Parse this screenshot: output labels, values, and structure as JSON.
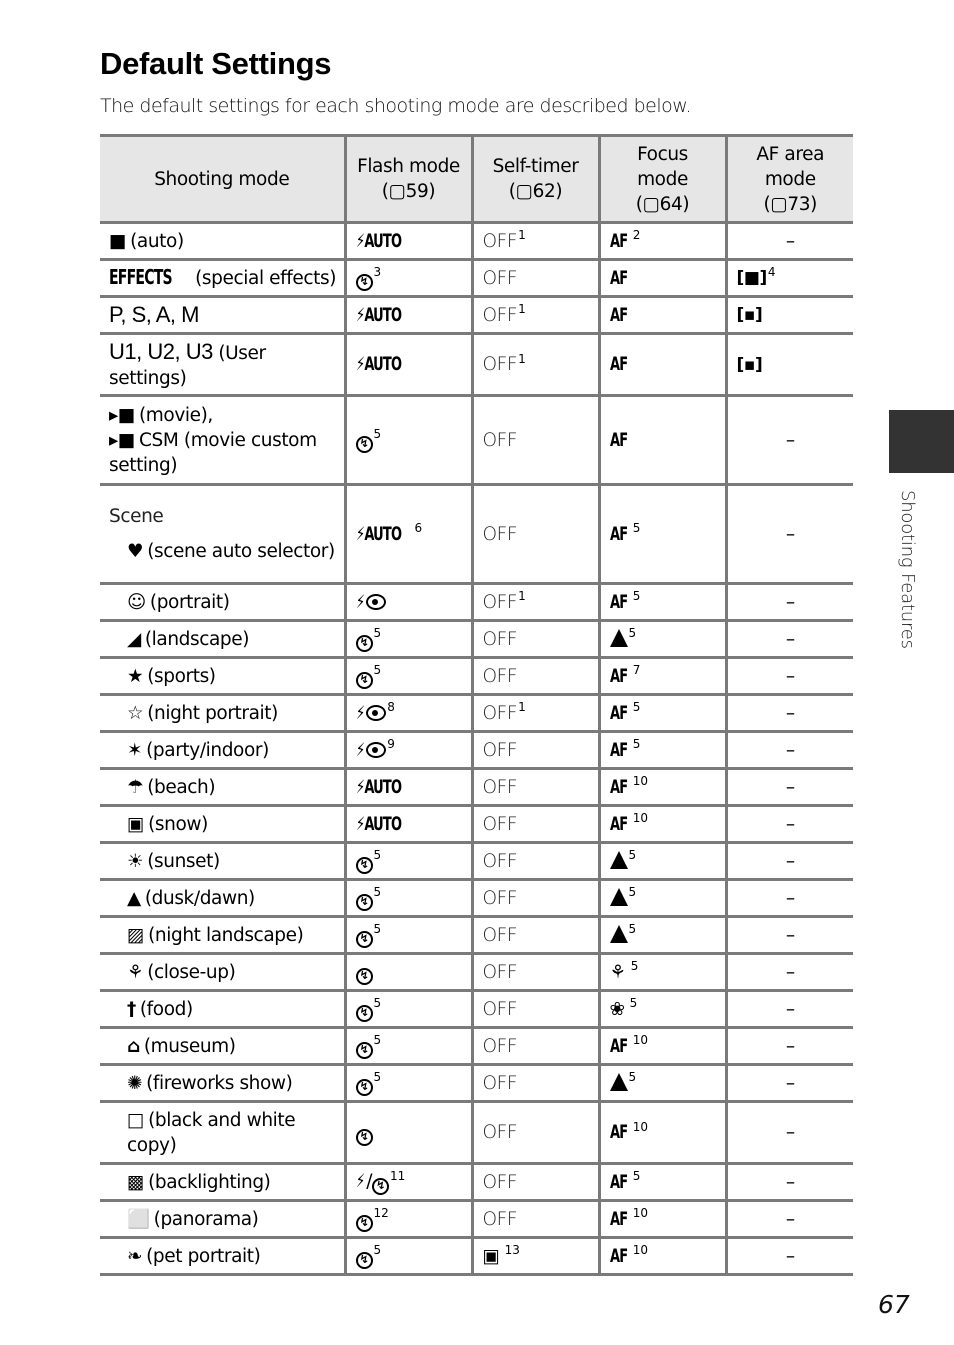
{
  "page": {
    "title": "Default Settings",
    "intro": "The default settings for each shooting mode are described below.",
    "side_tab_label": "Shooting Features",
    "page_number": "67"
  },
  "table": {
    "headers": [
      {
        "line1": "Shooting mode",
        "line2": "",
        "line3": ""
      },
      {
        "line1": "Flash mode",
        "line2": "(▢59)",
        "line3": ""
      },
      {
        "line1": "Self-timer",
        "line2": "(▢62)",
        "line3": ""
      },
      {
        "line1": "Focus",
        "line2": "mode",
        "line3": "(▢64)"
      },
      {
        "line1": "AF area",
        "line2": "mode",
        "line3": "(▢73)"
      }
    ],
    "rows": [
      {
        "icon": "camera-icon",
        "mode": "(auto)",
        "flash": "⚡AUTO",
        "flash_sup": "",
        "timer": "OFF",
        "timer_sup": "1",
        "focus": "AF",
        "focus_sup": "2",
        "area": "–",
        "area_sup": ""
      },
      {
        "icon": "effects-icon",
        "icon_text": "EFFECTS",
        "mode": "(special effects)",
        "flash": "flash-off",
        "flash_sup": "3",
        "timer": "OFF",
        "timer_sup": "",
        "focus": "AF",
        "focus_sup": "",
        "area": "[■]",
        "area_sup": "4"
      },
      {
        "mode": "P, S, A, M",
        "flash": "⚡AUTO",
        "flash_sup": "",
        "timer": "OFF",
        "timer_sup": "1",
        "focus": "AF",
        "focus_sup": "",
        "area": "[▪]",
        "area_sup": ""
      },
      {
        "mode_big": "U1, U2, U3",
        "mode": "(User settings)",
        "flash": "⚡AUTO",
        "flash_sup": "",
        "timer": "OFF",
        "timer_sup": "1",
        "focus": "AF",
        "focus_sup": "",
        "area": "[▪]",
        "area_sup": ""
      },
      {
        "mode": "(movie),",
        "mode2": "CSM (movie custom setting)",
        "flash": "flash-off",
        "flash_sup": "5",
        "timer": "OFF",
        "timer_sup": "",
        "focus": "AF",
        "focus_sup": "",
        "area": "–",
        "area_sup": ""
      }
    ],
    "scene_label": "Scene",
    "scene_rows": [
      {
        "icon": "scene-auto-icon",
        "mode": "(scene auto selector)",
        "flash": "⚡AUTO",
        "flash_type": "auto",
        "flash_sup": "6",
        "timer": "OFF",
        "timer_sup": "",
        "focus": "AF",
        "focus_type": "af",
        "focus_sup": "5",
        "area": "–"
      },
      {
        "icon": "portrait-icon",
        "mode": "(portrait)",
        "flash_type": "redeye",
        "flash_sup": "",
        "timer": "OFF",
        "timer_sup": "1",
        "focus": "AF",
        "focus_type": "af",
        "focus_sup": "5",
        "area": "–"
      },
      {
        "icon": "landscape-icon",
        "mode": "(landscape)",
        "flash_type": "off",
        "flash_sup": "5",
        "timer": "OFF",
        "timer_sup": "",
        "focus_type": "infinity",
        "focus_sup": "5",
        "area": "–"
      },
      {
        "icon": "sports-icon",
        "mode": "(sports)",
        "flash_type": "off",
        "flash_sup": "5",
        "timer": "OFF",
        "timer_sup": "",
        "focus": "AF",
        "focus_type": "af",
        "focus_sup": "7",
        "area": "–"
      },
      {
        "icon": "night-portrait-icon",
        "mode": "(night portrait)",
        "flash_type": "redeye",
        "flash_sup": "8",
        "timer": "OFF",
        "timer_sup": "1",
        "focus": "AF",
        "focus_type": "af",
        "focus_sup": "5",
        "area": "–"
      },
      {
        "icon": "party-icon",
        "mode": "(party/indoor)",
        "flash_type": "redeye",
        "flash_sup": "9",
        "timer": "OFF",
        "timer_sup": "",
        "focus": "AF",
        "focus_type": "af",
        "focus_sup": "5",
        "area": "–"
      },
      {
        "icon": "beach-icon",
        "mode": "(beach)",
        "flash_type": "auto",
        "flash": "⚡AUTO",
        "flash_sup": "",
        "timer": "OFF",
        "timer_sup": "",
        "focus": "AF",
        "focus_type": "af",
        "focus_sup": "10",
        "area": "–"
      },
      {
        "icon": "snow-icon",
        "mode": "(snow)",
        "flash_type": "auto",
        "flash": "⚡AUTO",
        "flash_sup": "",
        "timer": "OFF",
        "timer_sup": "",
        "focus": "AF",
        "focus_type": "af",
        "focus_sup": "10",
        "area": "–"
      },
      {
        "icon": "sunset-icon",
        "mode": "(sunset)",
        "flash_type": "off",
        "flash_sup": "5",
        "timer": "OFF",
        "timer_sup": "",
        "focus_type": "infinity",
        "focus_sup": "5",
        "area": "–"
      },
      {
        "icon": "dusk-dawn-icon",
        "mode": "(dusk/dawn)",
        "flash_type": "off",
        "flash_sup": "5",
        "timer": "OFF",
        "timer_sup": "",
        "focus_type": "infinity",
        "focus_sup": "5",
        "area": "–"
      },
      {
        "icon": "night-landscape-icon",
        "mode": "(night landscape)",
        "flash_type": "off",
        "flash_sup": "5",
        "timer": "OFF",
        "timer_sup": "",
        "focus_type": "infinity",
        "focus_sup": "5",
        "area": "–"
      },
      {
        "icon": "close-up-icon",
        "mode": "(close-up)",
        "flash_type": "off",
        "flash_sup": "",
        "timer": "OFF",
        "timer_sup": "",
        "focus_type": "macro-af",
        "focus_sup": "5",
        "area": "–"
      },
      {
        "icon": "food-icon",
        "mode": "(food)",
        "flash_type": "off",
        "flash_sup": "5",
        "timer": "OFF",
        "timer_sup": "",
        "focus_type": "macro",
        "focus_sup": "5",
        "area": "–"
      },
      {
        "icon": "museum-icon",
        "mode": "(museum)",
        "flash_type": "off",
        "flash_sup": "5",
        "timer": "OFF",
        "timer_sup": "",
        "focus": "AF",
        "focus_type": "af",
        "focus_sup": "10",
        "area": "–"
      },
      {
        "icon": "fireworks-icon",
        "mode": "(fireworks show)",
        "flash_type": "off",
        "flash_sup": "5",
        "timer": "OFF",
        "timer_sup": "",
        "focus_type": "infinity",
        "focus_sup": "5",
        "area": "–"
      },
      {
        "icon": "copy-icon",
        "mode": "(black and white copy)",
        "flash_type": "off",
        "flash_sup": "",
        "timer": "OFF",
        "timer_sup": "",
        "focus": "AF",
        "focus_type": "af",
        "focus_sup": "10",
        "area": "–"
      },
      {
        "icon": "backlighting-icon",
        "mode": "(backlighting)",
        "flash_type": "fill-or-off",
        "flash_sup": "11",
        "timer": "OFF",
        "timer_sup": "",
        "focus": "AF",
        "focus_type": "af",
        "focus_sup": "5",
        "area": "–"
      },
      {
        "icon": "panorama-icon",
        "mode": "(panorama)",
        "flash_type": "off",
        "flash_sup": "12",
        "timer": "OFF",
        "timer_sup": "",
        "focus": "AF",
        "focus_type": "af",
        "focus_sup": "10",
        "area": "–"
      },
      {
        "icon": "pet-portrait-icon",
        "mode": "(pet portrait)",
        "flash_type": "off",
        "flash_sup": "5",
        "timer_type": "pet-auto-release",
        "timer": "",
        "timer_sup": "13",
        "focus": "AF",
        "focus_type": "af",
        "focus_sup": "10",
        "area": "–"
      }
    ]
  }
}
